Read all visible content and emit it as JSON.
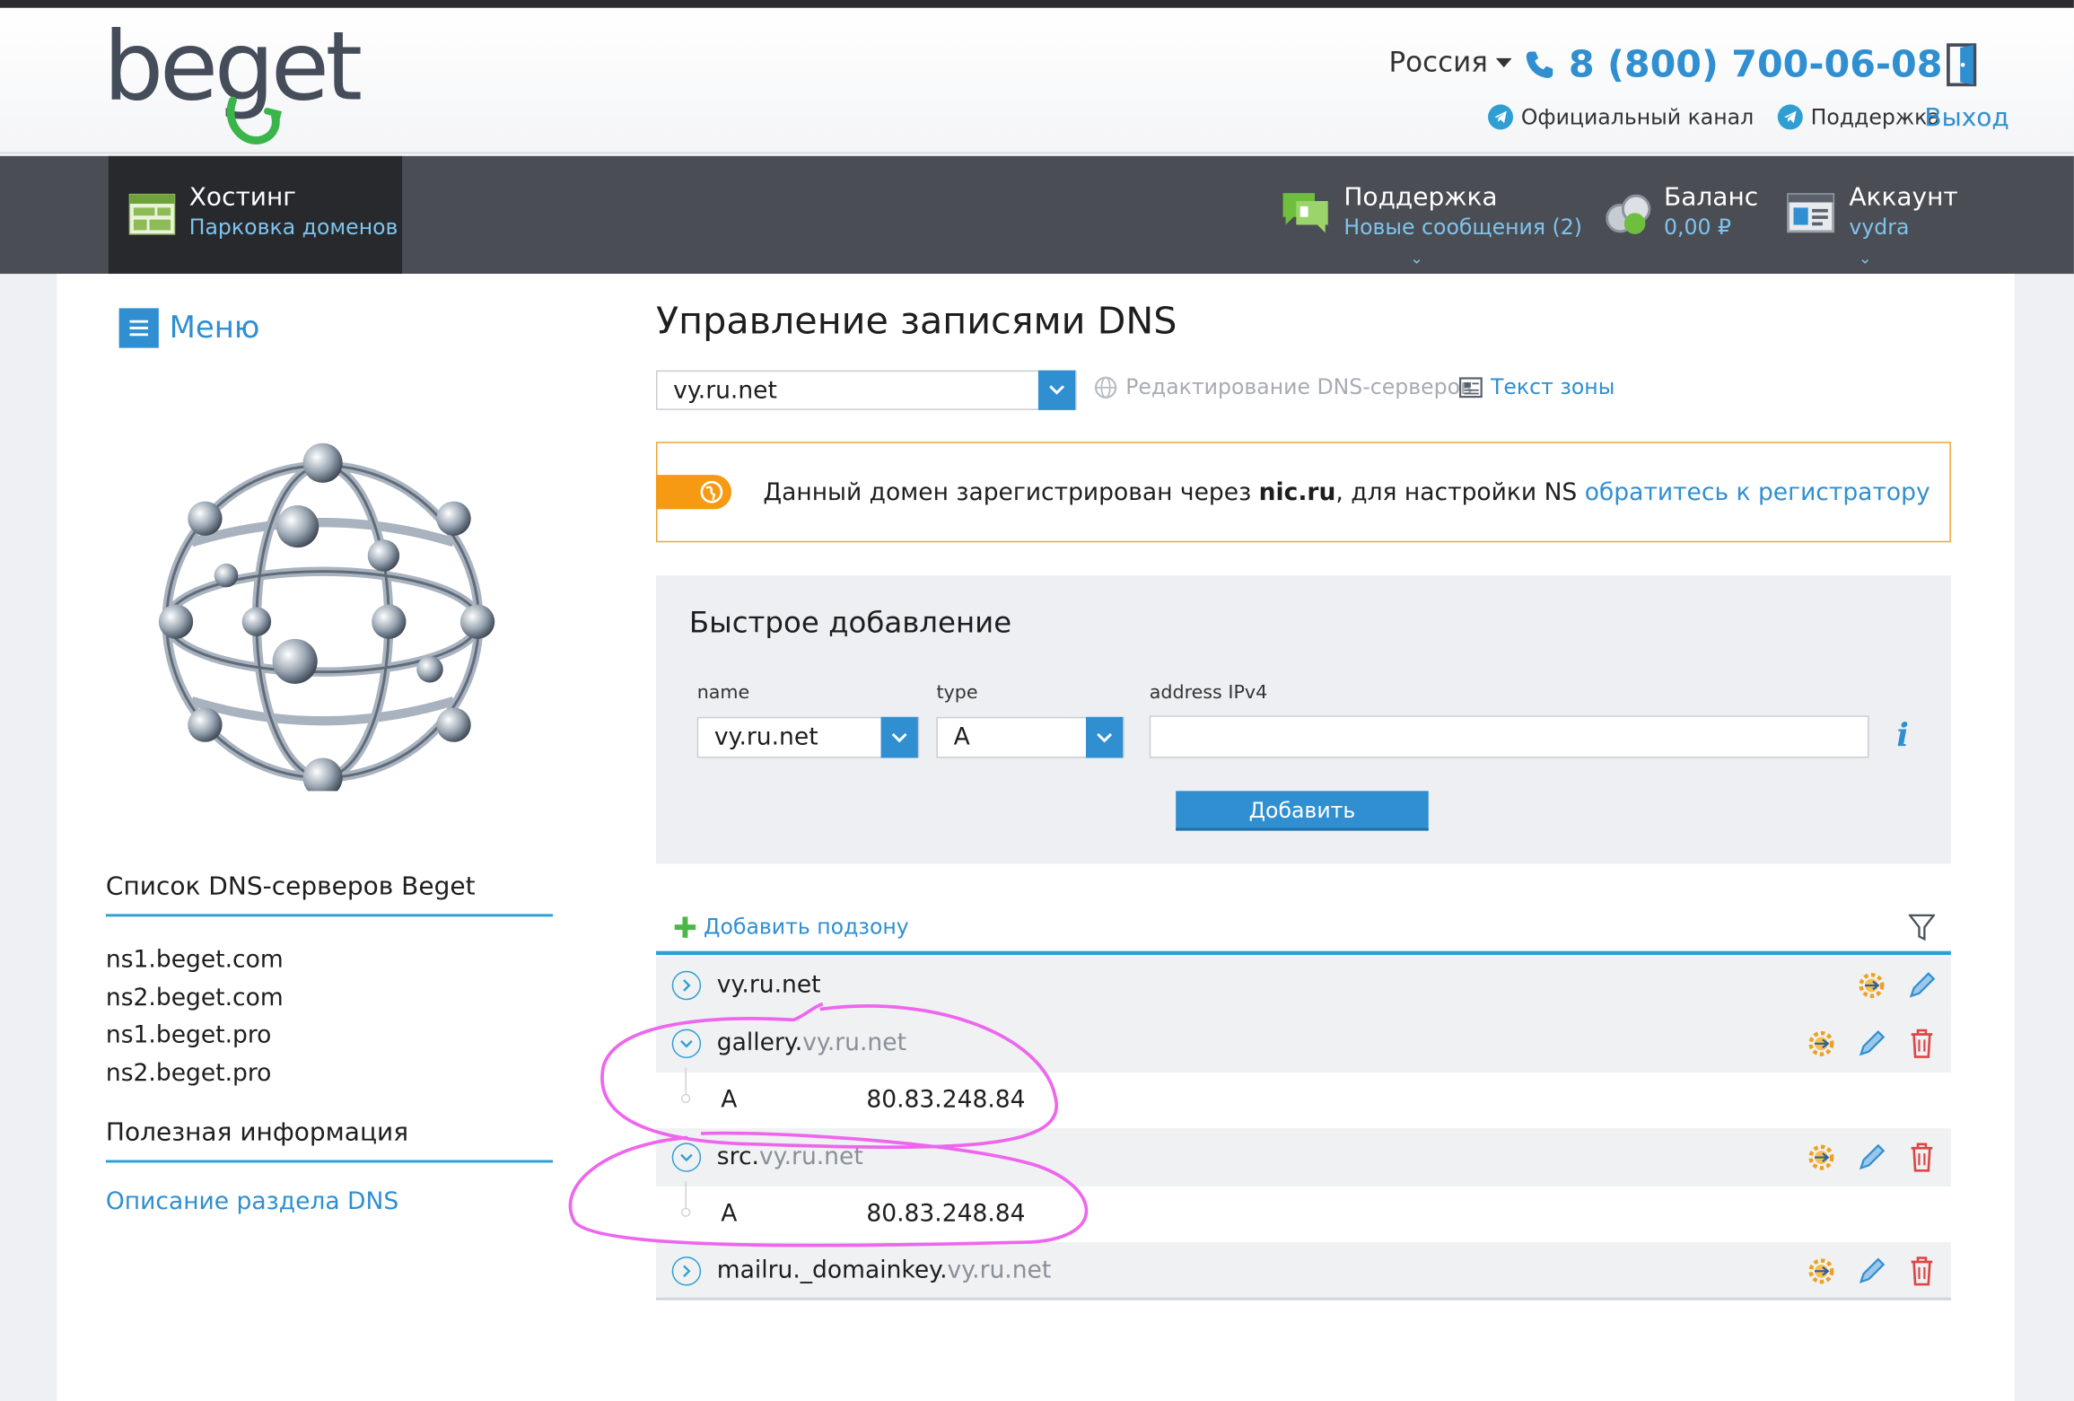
{
  "header": {
    "logo": "beget",
    "region": "Россия",
    "phone": "8 (800) 700-06-08",
    "official_channel": "Официальный канал",
    "support_link": "Поддержка",
    "logout": "Выход"
  },
  "nav": {
    "hosting_title": "Хостинг",
    "hosting_sub": "Парковка доменов",
    "support_title": "Поддержка",
    "support_sub": "Новые сообщения (2)",
    "balance_title": "Баланс",
    "balance_sub": "0,00 ₽",
    "account_title": "Аккаунт",
    "account_sub": "vydra"
  },
  "sidebar": {
    "menu_label": "Меню",
    "dns_list_title": "Список DNS-серверов Beget",
    "dns_servers": [
      "ns1.beget.com",
      "ns2.beget.com",
      "ns1.beget.pro",
      "ns2.beget.pro"
    ],
    "useful_title": "Полезная информация",
    "dns_description_link": "Описание раздела DNS"
  },
  "main": {
    "page_title": "Управление записями DNS",
    "domain_select": "vy.ru.net",
    "edit_dns_servers": "Редактирование DNS-серверов",
    "zone_text": "Текст зоны",
    "notice": {
      "before": "Данный домен зарегистрирован через ",
      "registrar": "nic.ru",
      "middle": ", для настройки NS ",
      "link": "обратитесь к регистратору"
    }
  },
  "quick_add": {
    "title": "Быстрое добавление",
    "name_label": "name",
    "name_value": "vy.ru.net",
    "type_label": "type",
    "type_value": "A",
    "address_label": "address IPv4",
    "address_value": "",
    "add_button": "Добавить"
  },
  "records": {
    "add_subzone": "Добавить подзону",
    "zones": [
      {
        "prefix": "",
        "domain": "vy.ru.net"
      },
      {
        "prefix": "gallery.",
        "domain": "vy.ru.net",
        "type": "A",
        "value": "80.83.248.84"
      },
      {
        "prefix": "src.",
        "domain": "vy.ru.net",
        "type": "A",
        "value": "80.83.248.84"
      },
      {
        "prefix": "mailru._domainkey.",
        "domain": "vy.ru.net"
      }
    ]
  },
  "colors": {
    "accent": "#2f8fd1",
    "navbar": "#4a4d54",
    "notice_border": "#f0a530",
    "annotation": "#ee66ee",
    "delete": "#e04545"
  }
}
